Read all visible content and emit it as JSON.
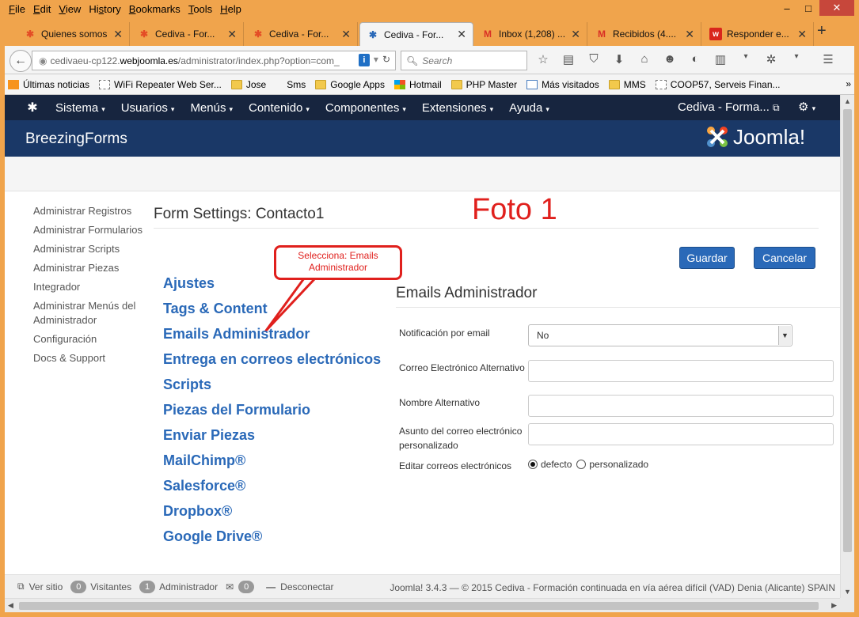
{
  "menubar": {
    "items": [
      "File",
      "Edit",
      "View",
      "History",
      "Bookmarks",
      "Tools",
      "Help"
    ],
    "underline": [
      "F",
      "E",
      "V",
      "s",
      "B",
      "T",
      "H"
    ]
  },
  "window_controls": {
    "minimize": "–",
    "maximize": "□",
    "close": "✕"
  },
  "tabs": [
    {
      "label": "Quienes somos",
      "icon": "joomla-icon",
      "active": false
    },
    {
      "label": "Cediva - For...",
      "icon": "joomla-icon",
      "active": false
    },
    {
      "label": "Cediva - For...",
      "icon": "joomla-icon",
      "active": false
    },
    {
      "label": "Cediva - For...",
      "icon": "joomla-icon",
      "active": true
    },
    {
      "label": "Inbox (1,208) ...",
      "icon": "gmail-icon",
      "active": false
    },
    {
      "label": "Recibidos (4....",
      "icon": "gmail-icon",
      "active": false
    },
    {
      "label": "Responder e...",
      "icon": "webnode-icon",
      "active": false
    }
  ],
  "newtab_label": "+",
  "url": {
    "prefix": "cedivaeu-cp122.",
    "host": "webjoomla.es",
    "path": "/administrator/index.php?option=com_"
  },
  "search": {
    "placeholder": "Search"
  },
  "bookmarks": [
    {
      "label": "Últimas noticias",
      "icon": "rss"
    },
    {
      "label": "WiFi Repeater Web Ser...",
      "icon": "page"
    },
    {
      "label": "Jose",
      "icon": "folder"
    },
    {
      "label": "Sms",
      "icon": "none"
    },
    {
      "label": "Google Apps",
      "icon": "folder"
    },
    {
      "label": "Hotmail",
      "icon": "ms"
    },
    {
      "label": "PHP Master",
      "icon": "folder"
    },
    {
      "label": "Más visitados",
      "icon": "page"
    },
    {
      "label": "MMS",
      "icon": "folder"
    },
    {
      "label": "COOP57, Serveis Finan...",
      "icon": "page"
    }
  ],
  "bookmarks_more": "»",
  "joomla_nav": {
    "items": [
      "Sistema",
      "Usuarios",
      "Menús",
      "Contenido",
      "Componentes",
      "Extensiones",
      "Ayuda"
    ],
    "site_label": "Cediva - Forma...",
    "caret": "▾"
  },
  "header": {
    "title": "BreezingForms",
    "brand": "Joomla!"
  },
  "sidebar": [
    "Administrar Registros",
    "Administrar Formularios",
    "Administrar Scripts",
    "Administrar Piezas",
    "Integrador",
    "Administrar Menús del Administrador",
    "Configuración",
    "Docs & Support"
  ],
  "content": {
    "title": "Form Settings: Contacto1",
    "annotation_foto": "Foto 1",
    "callout": "Selecciona: Emails Administrador",
    "save_label": "Guardar",
    "cancel_label": "Cancelar"
  },
  "settings_nav": [
    "Ajustes",
    "Tags & Content",
    "Emails Administrador",
    "Entrega en correos electrónicos",
    "Scripts",
    "Piezas del Formulario",
    "Enviar Piezas",
    "MailChimp®",
    "Salesforce®",
    "Dropbox®",
    "Google Drive®"
  ],
  "panel": {
    "title": "Emails Administrador",
    "fields": {
      "notification_label": "Notificación por email",
      "notification_value": "No",
      "alt_email_label": "Correo Electrónico Alternativo",
      "alt_email_value": "",
      "alt_name_label": "Nombre Alternativo",
      "alt_name_value": "",
      "subject_label": "Asunto del correo electrónico personalizado",
      "subject_value": "",
      "edit_label": "Editar correos electrónicos",
      "radio_default": "defecto",
      "radio_custom": "personalizado"
    }
  },
  "status": {
    "view_site": "Ver sitio",
    "visitors_count": "0",
    "visitors_label": "Visitantes",
    "admin_count": "1",
    "admin_label": "Administrador",
    "messages_count": "0",
    "logout_label": "Desconectar",
    "copyright": "Joomla! 3.4.3  —  © 2015 Cediva - Formación continuada en vía aérea difícil (VAD) Denia (Alicante) SPAIN"
  },
  "colors": {
    "firefox_frame": "#f0a44c",
    "joomla_nav": "#17253f",
    "joomla_header": "#1a3867",
    "link_blue": "#2a69b8",
    "annotation_red": "#e0201d"
  }
}
